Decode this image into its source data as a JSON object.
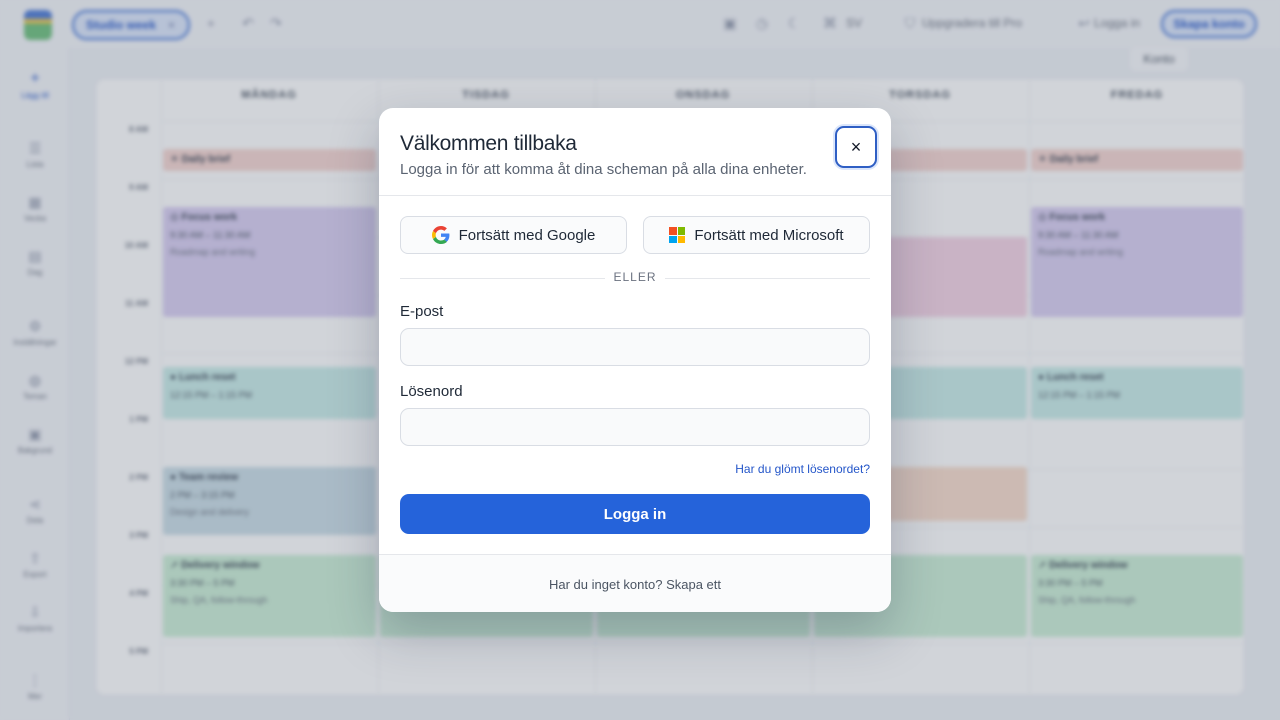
{
  "topbar": {
    "tab_label": "Studio week",
    "tab_close": "×",
    "add_tab": "+",
    "language": "SV",
    "upgrade": "Uppgradera till Pro",
    "login": "Logga in",
    "create_account": "Skapa konto",
    "tooltip": "Konto"
  },
  "sidebar": {
    "items": [
      {
        "label": "Lägg till",
        "icon": "plus-icon"
      },
      {
        "label": "Lista",
        "icon": "list-icon"
      },
      {
        "label": "Vecka",
        "icon": "week-icon"
      },
      {
        "label": "Dag",
        "icon": "calendar-icon"
      },
      {
        "label": "Inställningar",
        "icon": "gear-icon"
      },
      {
        "label": "Teman",
        "icon": "palette-icon"
      },
      {
        "label": "Bakgrund",
        "icon": "image-icon"
      },
      {
        "label": "Dela",
        "icon": "share-icon"
      },
      {
        "label": "Export",
        "icon": "export-icon"
      },
      {
        "label": "Importera",
        "icon": "import-icon"
      },
      {
        "label": "Mer",
        "icon": "more-icon"
      }
    ]
  },
  "calendar": {
    "days": [
      "MÅNDAG",
      "TISDAG",
      "ONSDAG",
      "TORSDAG",
      "FREDAG"
    ],
    "hours": [
      "8 AM",
      "9 AM",
      "10 AM",
      "11 AM",
      "12 PM",
      "1 PM",
      "2 PM",
      "3 PM",
      "4 PM",
      "5 PM"
    ],
    "events": {
      "brief": {
        "title": "Daily brief"
      },
      "focus": {
        "title": "Focus work",
        "time": "9:30 AM – 11:30 AM",
        "desc": "Roadmap and writing"
      },
      "lunch": {
        "title": "Lunch reset",
        "time": "12:15 PM – 1:15 PM"
      },
      "review": {
        "title": "Team review",
        "time": "2 PM – 3:15 PM",
        "desc": "Design and delivery"
      },
      "delivery": {
        "title": "Delivery window",
        "time": "3:30 PM – 5 PM",
        "desc": "Ship, QA, follow-through"
      }
    }
  },
  "modal": {
    "title": "Välkommen tillbaka",
    "subtitle": "Logga in för att komma åt dina scheman på alla dina enheter.",
    "close": "×",
    "google": "Fortsätt med Google",
    "microsoft": "Fortsätt med Microsoft",
    "or": "ELLER",
    "email_label": "E-post",
    "email_value": "",
    "password_label": "Lösenord",
    "password_value": "",
    "forgot": "Har du glömt lösenordet?",
    "login_button": "Logga in",
    "footer_text": "Har du inget konto?",
    "footer_link": "Skapa ett"
  },
  "colors": {
    "accent": "#2563da",
    "link": "#2456c9"
  }
}
